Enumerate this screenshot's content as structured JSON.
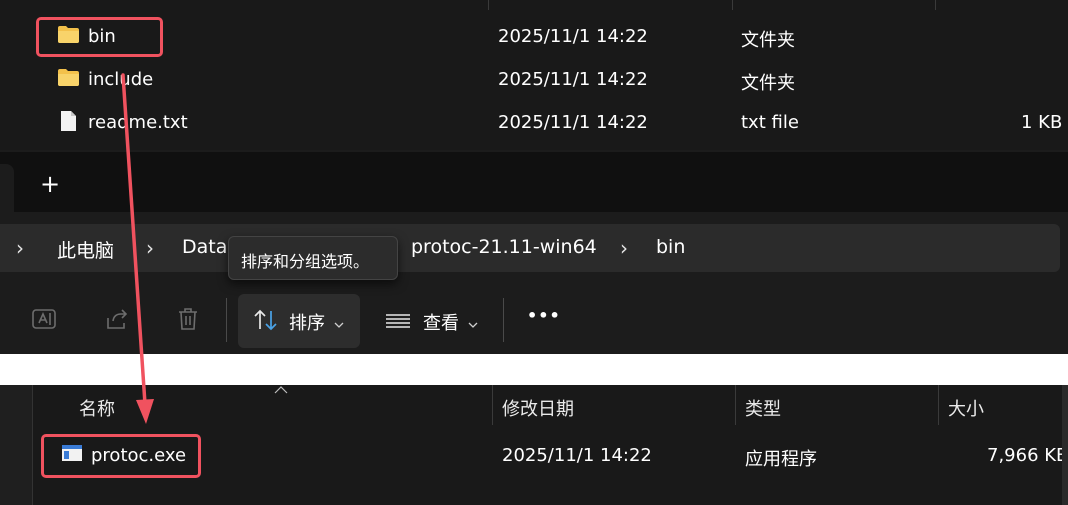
{
  "top_list": {
    "rows": [
      {
        "name": "bin",
        "date": "2025/11/1 14:22",
        "type": "文件夹",
        "size": "",
        "icon": "folder-icon"
      },
      {
        "name": "include",
        "date": "2025/11/1 14:22",
        "type": "文件夹",
        "size": "",
        "icon": "folder-icon"
      },
      {
        "name": "readme.txt",
        "date": "2025/11/1 14:22",
        "type": "txt file",
        "size": "1 KB",
        "icon": "text-file-icon"
      }
    ]
  },
  "tabbar": {
    "new_tab": "+"
  },
  "breadcrumb": {
    "items": [
      "此电脑",
      "Data",
      "protoc-21.11-win64",
      "bin"
    ]
  },
  "tooltip": {
    "text": "排序和分组选项。"
  },
  "toolbar": {
    "sort_label": "排序",
    "view_label": "查看",
    "more_label": "•••"
  },
  "bottom_list": {
    "headers": {
      "name": "名称",
      "date": "修改日期",
      "type": "类型",
      "size": "大小"
    },
    "rows": [
      {
        "name": "protoc.exe",
        "date": "2025/11/1 14:22",
        "type": "应用程序",
        "size": "7,966 KB",
        "icon": "exe-file-icon"
      }
    ]
  },
  "colors": {
    "highlight": "#f0525f",
    "folder": "#f3c14b",
    "background": "#191919"
  }
}
